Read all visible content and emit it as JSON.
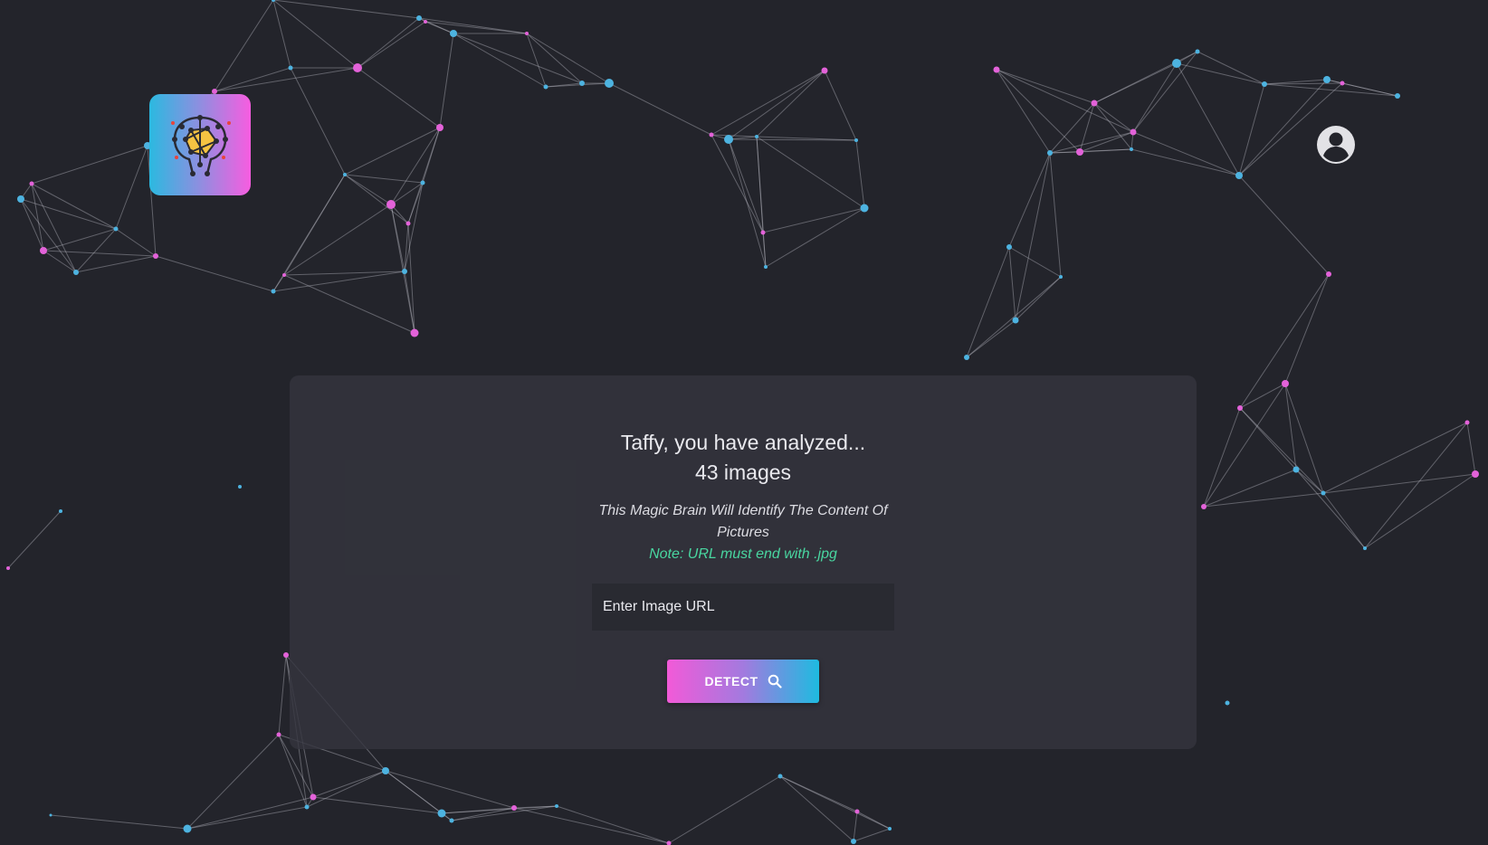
{
  "header": {
    "logo_icon": "brain-network-icon",
    "profile_icon": "user-account-icon"
  },
  "main": {
    "greeting": "Taffy, you have analyzed...",
    "count": "43 images",
    "tagline": "This Magic Brain Will Identify The Content Of Pictures",
    "note": "Note: URL must end with .jpg",
    "input_placeholder": "Enter Image URL",
    "detect_label": "DETECT",
    "detect_icon": "search-icon"
  },
  "colors": {
    "background": "#23242b",
    "card": "#34353e",
    "accent_pink": "#f25ad8",
    "accent_blue": "#1ebbe0",
    "note_green": "#49d6a0"
  }
}
